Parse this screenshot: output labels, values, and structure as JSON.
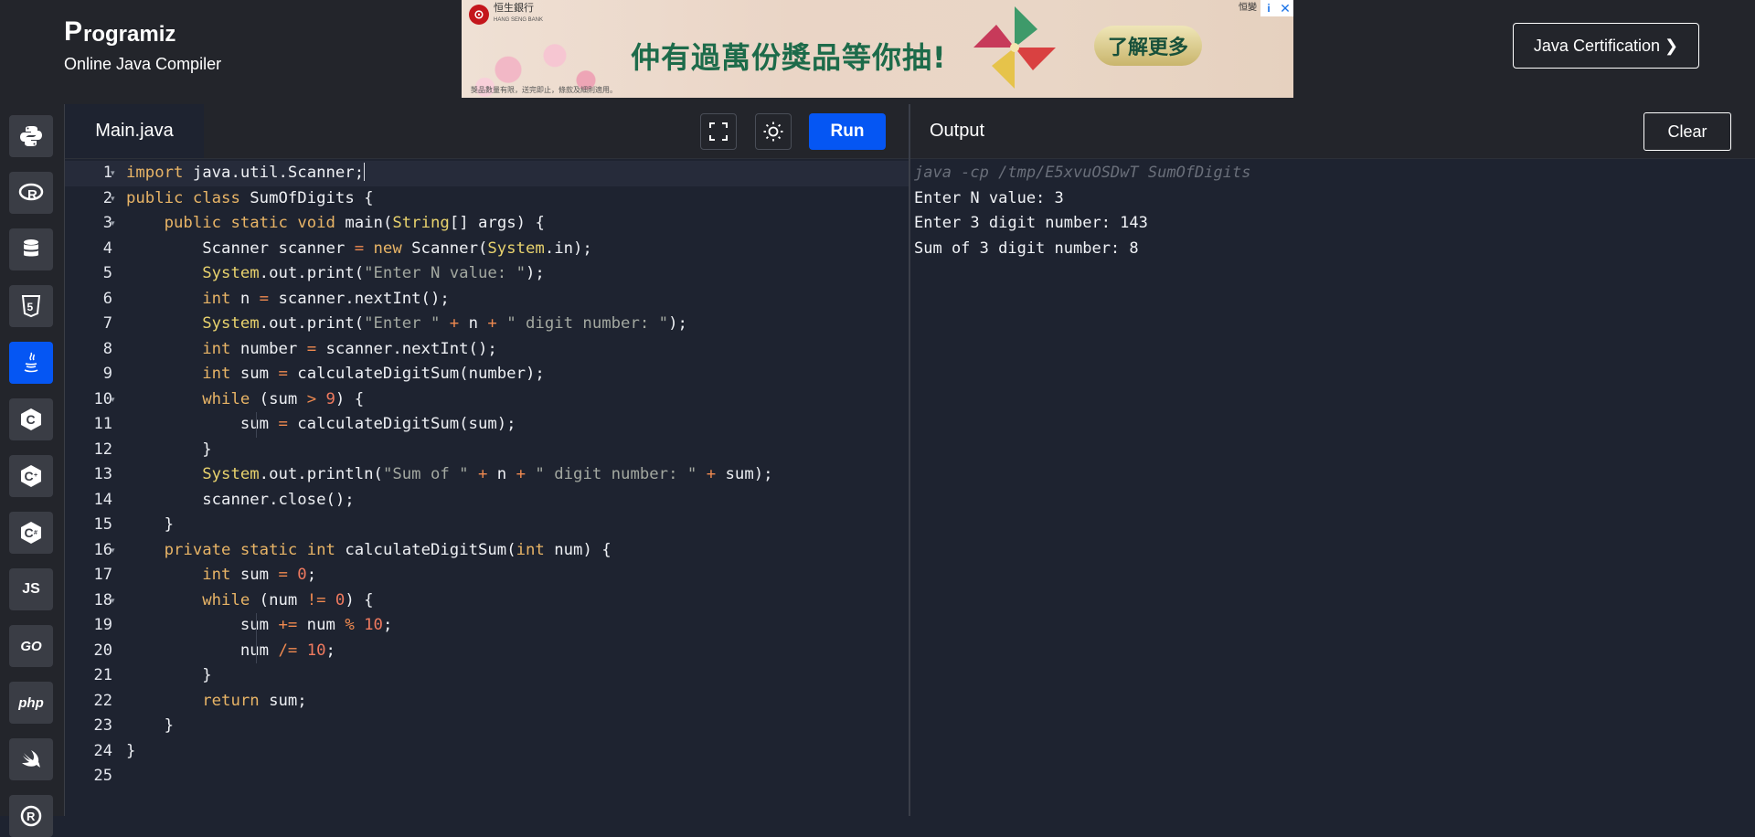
{
  "header": {
    "brand_name": "rogramiz",
    "brand_letter": "P",
    "subtitle": "Online Java Compiler",
    "certification_button": "Java Certification ❯"
  },
  "ad": {
    "bank_name": "恒生銀行",
    "bank_name_en": "HANG SENG BANK",
    "headline": "仲有過萬份獎品等你抽!",
    "cta": "了解更多",
    "corner_brand": "恒變",
    "fine_print": "獎品數量有限，送完即止，條款及細則適用。"
  },
  "sidebar": {
    "items": [
      {
        "name": "python",
        "icon": "python-icon"
      },
      {
        "name": "r",
        "icon": "r-icon",
        "label": "R"
      },
      {
        "name": "sql",
        "icon": "database-icon"
      },
      {
        "name": "html",
        "icon": "html5-icon",
        "label": "5"
      },
      {
        "name": "java",
        "icon": "java-icon",
        "active": true
      },
      {
        "name": "c",
        "icon": "c-icon",
        "label": "C"
      },
      {
        "name": "cpp",
        "icon": "cpp-icon",
        "label": "C"
      },
      {
        "name": "csharp",
        "icon": "csharp-icon",
        "label": "C"
      },
      {
        "name": "js",
        "icon": "javascript-icon",
        "label": "JS"
      },
      {
        "name": "go",
        "icon": "go-icon",
        "label": "GO"
      },
      {
        "name": "php",
        "icon": "php-icon",
        "label": "php"
      },
      {
        "name": "swift",
        "icon": "swift-icon"
      },
      {
        "name": "rust",
        "icon": "rust-icon"
      }
    ]
  },
  "editor": {
    "tab_label": "Main.java",
    "run_label": "Run",
    "fullscreen_icon": "fullscreen-icon",
    "theme_icon": "sun-icon",
    "line_numbers": [
      "1",
      "2",
      "3",
      "4",
      "5",
      "6",
      "7",
      "8",
      "9",
      "10",
      "11",
      "12",
      "13",
      "14",
      "15",
      "16",
      "17",
      "18",
      "19",
      "20",
      "21",
      "22",
      "23",
      "24",
      "25"
    ],
    "lines": [
      [
        [
          "kw",
          "import"
        ],
        [
          "pl",
          " java.util.Scanner;"
        ]
      ],
      [
        [
          "kw",
          "public"
        ],
        [
          "pl",
          " "
        ],
        [
          "kw",
          "class"
        ],
        [
          "pl",
          " SumOfDigits {"
        ]
      ],
      [
        [
          "pl",
          "    "
        ],
        [
          "kw",
          "public"
        ],
        [
          "pl",
          " "
        ],
        [
          "kw",
          "static"
        ],
        [
          "pl",
          " "
        ],
        [
          "kw",
          "void"
        ],
        [
          "pl",
          " main("
        ],
        [
          "ty",
          "String"
        ],
        [
          "pl",
          "[] args) {"
        ]
      ],
      [
        [
          "pl",
          "        Scanner scanner "
        ],
        [
          "op",
          "="
        ],
        [
          "pl",
          " "
        ],
        [
          "kw",
          "new"
        ],
        [
          "pl",
          " Scanner("
        ],
        [
          "ty",
          "System"
        ],
        [
          "pl",
          ".in);"
        ]
      ],
      [
        [
          "pl",
          "        "
        ],
        [
          "ty",
          "System"
        ],
        [
          "pl",
          ".out.print("
        ],
        [
          "str",
          "\"Enter N value: \""
        ],
        [
          "pl",
          ");"
        ]
      ],
      [
        [
          "pl",
          "        "
        ],
        [
          "kw",
          "int"
        ],
        [
          "pl",
          " n "
        ],
        [
          "op",
          "="
        ],
        [
          "pl",
          " scanner.nextInt();"
        ]
      ],
      [
        [
          "pl",
          "        "
        ],
        [
          "ty",
          "System"
        ],
        [
          "pl",
          ".out.print("
        ],
        [
          "str",
          "\"Enter \""
        ],
        [
          "pl",
          " "
        ],
        [
          "op",
          "+"
        ],
        [
          "pl",
          " n "
        ],
        [
          "op",
          "+"
        ],
        [
          "pl",
          " "
        ],
        [
          "str",
          "\" digit number: \""
        ],
        [
          "pl",
          ");"
        ]
      ],
      [
        [
          "pl",
          "        "
        ],
        [
          "kw",
          "int"
        ],
        [
          "pl",
          " number "
        ],
        [
          "op",
          "="
        ],
        [
          "pl",
          " scanner.nextInt();"
        ]
      ],
      [
        [
          "pl",
          "        "
        ],
        [
          "kw",
          "int"
        ],
        [
          "pl",
          " sum "
        ],
        [
          "op",
          "="
        ],
        [
          "pl",
          " calculateDigitSum(number);"
        ]
      ],
      [
        [
          "pl",
          "        "
        ],
        [
          "kw",
          "while"
        ],
        [
          "pl",
          " (sum "
        ],
        [
          "op",
          ">"
        ],
        [
          "pl",
          " "
        ],
        [
          "num",
          "9"
        ],
        [
          "pl",
          ") {"
        ]
      ],
      [
        [
          "pl",
          "            sum "
        ],
        [
          "op",
          "="
        ],
        [
          "pl",
          " calculateDigitSum(sum);"
        ]
      ],
      [
        [
          "pl",
          "        }"
        ]
      ],
      [
        [
          "pl",
          "        "
        ],
        [
          "ty",
          "System"
        ],
        [
          "pl",
          ".out.println("
        ],
        [
          "str",
          "\"Sum of \""
        ],
        [
          "pl",
          " "
        ],
        [
          "op",
          "+"
        ],
        [
          "pl",
          " n "
        ],
        [
          "op",
          "+"
        ],
        [
          "pl",
          " "
        ],
        [
          "str",
          "\" digit number: \""
        ],
        [
          "pl",
          " "
        ],
        [
          "op",
          "+"
        ],
        [
          "pl",
          " sum);"
        ]
      ],
      [
        [
          "pl",
          "        scanner.close();"
        ]
      ],
      [
        [
          "pl",
          "    }"
        ]
      ],
      [
        [
          "pl",
          "    "
        ],
        [
          "kw",
          "private"
        ],
        [
          "pl",
          " "
        ],
        [
          "kw",
          "static"
        ],
        [
          "pl",
          " "
        ],
        [
          "kw",
          "int"
        ],
        [
          "pl",
          " calculateDigitSum("
        ],
        [
          "kw",
          "int"
        ],
        [
          "pl",
          " num) {"
        ]
      ],
      [
        [
          "pl",
          "        "
        ],
        [
          "kw",
          "int"
        ],
        [
          "pl",
          " sum "
        ],
        [
          "op",
          "="
        ],
        [
          "pl",
          " "
        ],
        [
          "num",
          "0"
        ],
        [
          "pl",
          ";"
        ]
      ],
      [
        [
          "pl",
          "        "
        ],
        [
          "kw",
          "while"
        ],
        [
          "pl",
          " (num "
        ],
        [
          "op",
          "!="
        ],
        [
          "pl",
          " "
        ],
        [
          "num",
          "0"
        ],
        [
          "pl",
          ") {"
        ]
      ],
      [
        [
          "pl",
          "            sum "
        ],
        [
          "op",
          "+="
        ],
        [
          "pl",
          " num "
        ],
        [
          "op",
          "%"
        ],
        [
          "pl",
          " "
        ],
        [
          "num",
          "10"
        ],
        [
          "pl",
          ";"
        ]
      ],
      [
        [
          "pl",
          "            num "
        ],
        [
          "op",
          "/="
        ],
        [
          "pl",
          " "
        ],
        [
          "num",
          "10"
        ],
        [
          "pl",
          ";"
        ]
      ],
      [
        [
          "pl",
          "        }"
        ]
      ],
      [
        [
          "pl",
          "        "
        ],
        [
          "kw",
          "return"
        ],
        [
          "pl",
          " sum;"
        ]
      ],
      [
        [
          "pl",
          "    }"
        ]
      ],
      [
        [
          "pl",
          "}"
        ]
      ],
      [
        [
          "pl",
          ""
        ]
      ]
    ],
    "fold_lines": [
      1,
      2,
      3,
      10,
      16,
      18
    ]
  },
  "output": {
    "title": "Output",
    "clear_label": "Clear",
    "command": "java -cp /tmp/E5xvuOSDwT SumOfDigits",
    "lines": [
      "Enter N value: 3",
      "Enter 3 digit number: 143",
      "Sum of 3 digit number: 8"
    ]
  },
  "colors": {
    "accent": "#0556f3",
    "header_bg": "#23252b",
    "editor_bg": "#1e2330",
    "keyword": "#e8b466",
    "type": "#e8d26d",
    "number": "#f07a5f",
    "string": "#a3a8a0"
  }
}
